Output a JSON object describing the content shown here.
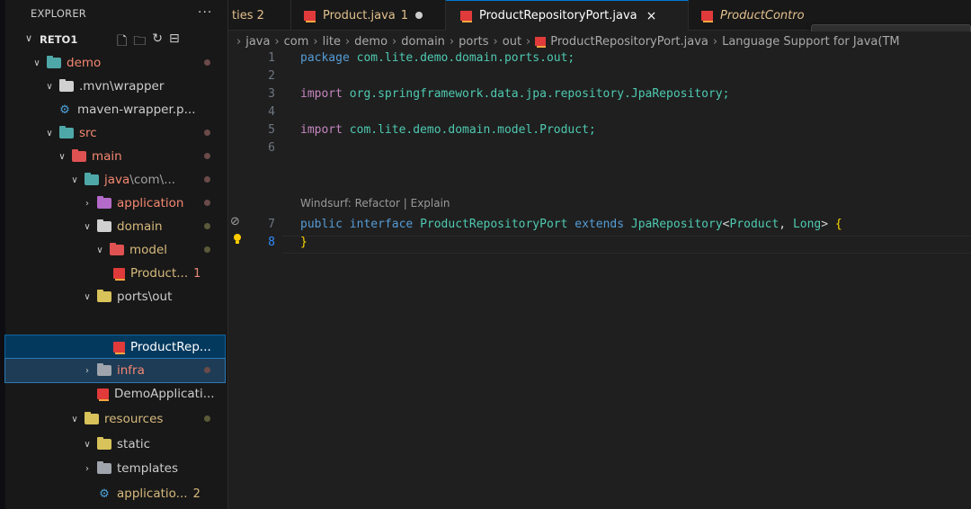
{
  "explorer": {
    "title": "EXPLORER",
    "more_icon": "ellipsis-icon",
    "root_label": "RETO1",
    "actions": [
      "new-file-icon",
      "new-folder-icon",
      "refresh-icon",
      "collapse-all-icon"
    ]
  },
  "tree": [
    {
      "label": "demo",
      "badge": ""
    },
    {
      "label": ".mvn",
      "label2": "\\wrapper",
      "badge": ""
    },
    {
      "label": "maven-wrapper.p...",
      "badge": ""
    },
    {
      "label": "src",
      "badge": ""
    },
    {
      "label": "main",
      "badge": ""
    },
    {
      "label": "java",
      "label2": "\\com\\...",
      "badge": ""
    },
    {
      "label": "application",
      "badge": ""
    },
    {
      "label": "domain",
      "badge": ""
    },
    {
      "label": "model",
      "badge": ""
    },
    {
      "label": "Product...",
      "badge": "1"
    },
    {
      "label": "ports",
      "label2": "\\out",
      "badge": ""
    },
    {
      "label": "ProductRep...",
      "badge": ""
    },
    {
      "label": "infra",
      "badge": ""
    },
    {
      "label": "DemoApplicati...",
      "badge": ""
    },
    {
      "label": "resources",
      "badge": ""
    },
    {
      "label": "static",
      "badge": ""
    },
    {
      "label": "templates",
      "badge": ""
    },
    {
      "label": "applicatio...",
      "badge": "2"
    }
  ],
  "tabs": [
    {
      "label": "ties 2"
    },
    {
      "label": "Product.java",
      "problems": "1"
    },
    {
      "label": "ProductRepositoryPort.java",
      "close": "×"
    },
    {
      "label": "ProductContro"
    }
  ],
  "debug_toolbar": [
    "drag-grip-icon",
    "pause-icon",
    "step-over-icon",
    "step-into-icon",
    "step-out-icon",
    "restart-icon"
  ],
  "breadcrumb": [
    "java",
    "com",
    "lite",
    "demo",
    "domain",
    "ports",
    "out",
    "ProductRepositoryPort.java",
    "Language Support for Java(TM"
  ],
  "editor": {
    "line_numbers": [
      "1",
      "2",
      "3",
      "4",
      "5",
      "6",
      "7",
      "8"
    ],
    "codelens": "Windsurf: Refactor | Explain",
    "lines": {
      "l1_kw": "package",
      "l1_rest": " com.lite.demo.domain.ports.out;",
      "l3_kw": "import",
      "l3_rest": " org.springframework.data.jpa.repository.JpaRepository;",
      "l5_kw": "import",
      "l5_rest": " com.lite.demo.domain.model.Product;",
      "l7_public": "public",
      "l7_interface": "interface",
      "l7_name": "ProductRepositoryPort",
      "l7_extends": "extends",
      "l7_super": "JpaRepository",
      "l7_lt": "<",
      "l7_t1": "Product",
      "l7_comma": ", ",
      "l7_t2": "Long",
      "l7_gt": ">",
      "l7_brace": "{",
      "l8_brace": "}"
    }
  },
  "colors": {
    "accent": "#0078d4",
    "java_icon": "#e03a3a",
    "keyword": "#569cd6",
    "type": "#4ec9b0",
    "warning": "#ffcc00"
  }
}
